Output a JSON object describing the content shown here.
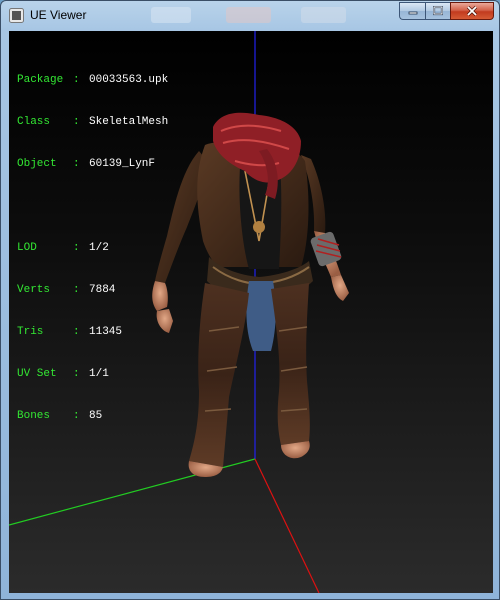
{
  "window": {
    "title": "UE Viewer",
    "buttons": [
      {
        "name": "minimize",
        "icon": "minimize-icon"
      },
      {
        "name": "maximize",
        "icon": "maximize-icon"
      },
      {
        "name": "close",
        "icon": "close-icon"
      }
    ]
  },
  "info": {
    "package_label": "Package",
    "package_value": "00033563.upk",
    "class_label": "Class",
    "class_value": "SkeletalMesh",
    "object_label": "Object",
    "object_value": "60139_LynF",
    "lod_label": "LOD",
    "lod_value": "1/2",
    "verts_label": "Verts",
    "verts_value": "7884",
    "tris_label": "Tris",
    "tris_value": "11345",
    "uvset_label": "UV Set",
    "uvset_value": "1/1",
    "bones_label": "Bones",
    "bones_value": "85",
    "separator": ":"
  },
  "colors": {
    "info_label": "#33e833",
    "info_value": "#ffffff",
    "axis_x": "#dd1111",
    "axis_y": "#22cc22",
    "axis_z": "#2222ee"
  }
}
